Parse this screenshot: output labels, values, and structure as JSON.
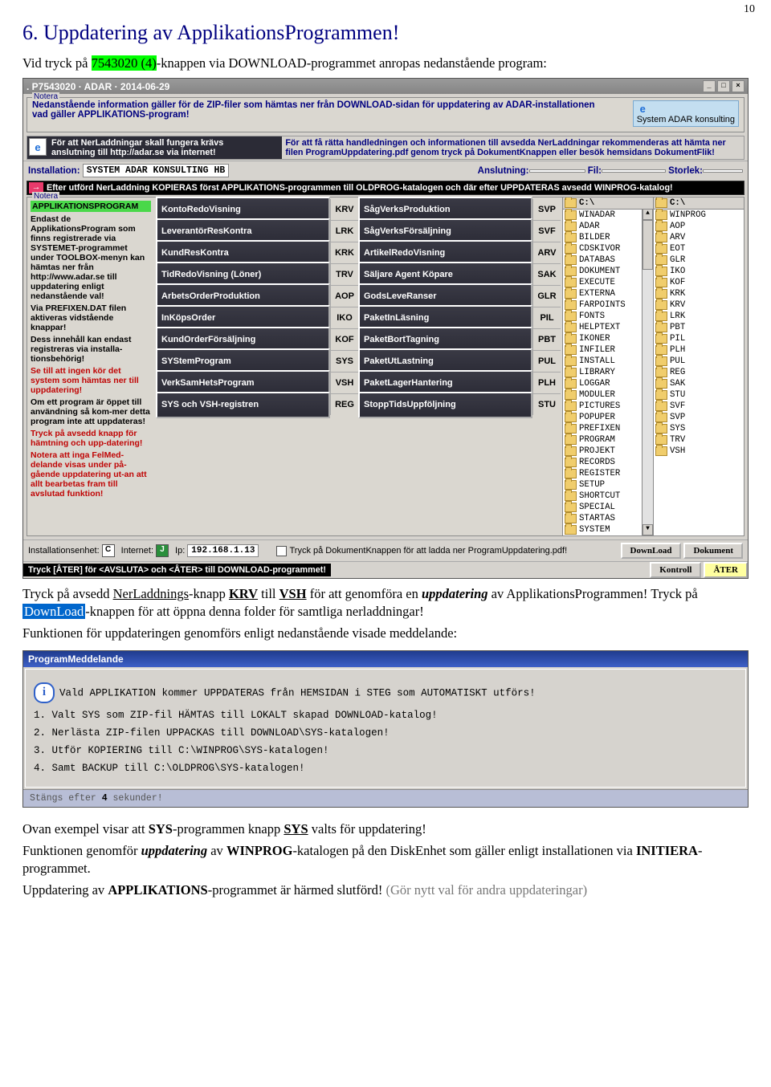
{
  "page_number": "10",
  "h1_num": "6.",
  "h1_text": " Uppdatering av ApplikationsProgrammen!",
  "intro_1": "Vid tryck på ",
  "intro_hl": "7543020 (4)",
  "intro_2": "-knappen via DOWNLOAD-programmet anropas nedanstående program:",
  "app": {
    "title": ". P7543020 · ADAR · 2014-06-29",
    "notera_label": "Notera",
    "notera1_l1": "Nedanstående information gäller för de ZIP-filer som hämtas ner från DOWNLOAD-sidan för uppdatering av ADAR-installationen",
    "notera1_l2": "vad gäller APPLIKATIONS-program!",
    "sysadar": "System ADAR konsulting",
    "ie1_l1": "För att NerLaddningar skall fungera krävs",
    "ie1_l2": "anslutning till http://adar.se via internet!",
    "ie1_r1": "För att få rätta handledningen och informationen till avsedda NerLaddningar rekommenderas att hämta ner",
    "ie1_r2": "filen ProgramUppdatering.pdf genom tryck på DokumentKnappen eller besök hemsidans DokumentFlik!",
    "inst_label": "Installation:",
    "inst_val": "SYSTEM ADAR KONSULTING HB",
    "ansl_lbl": "Anslutning:",
    "fil_lbl": "Fil:",
    "storlek_lbl": "Storlek:",
    "blackbar": "Efter utförd NerLaddning KOPIERAS först APPLIKATIONS-programmen till OLDPROG-katalogen och där efter UPPDATERAS avsedd WINPROG-katalog!",
    "appbox_title": "APPLIKATIONSPROGRAM",
    "appbox_l1": "Endast de ApplikationsProgram som finns registrerade via SYSTEMET-programmet under TOOLBOX-menyn kan hämtas ner från http://www.adar.se till uppdatering enligt nedanstående val!",
    "side_p1": "Via PREFIXEN.DAT filen aktiveras vidstående knappar!",
    "side_p2": "Dess innehåll kan endast registreras via installa-tionsbehörig!",
    "side_r1": "Se till att ingen kör det system som hämtas ner till uppdatering!",
    "side_p3": "Om ett program är öppet till användning så kom-mer detta program inte att uppdateras!",
    "side_r2": "Tryck på avsedd knapp för hämtning och upp-datering!",
    "side_p4": "Notera att inga FelMed-delande visas under på-gående uppdatering ut-an att allt bearbetas fram till avslutad funktion!",
    "col1": [
      {
        "t": "KontoRedoVisning",
        "c": "KRV"
      },
      {
        "t": "LeverantörResKontra",
        "c": "LRK"
      },
      {
        "t": "KundResKontra",
        "c": "KRK"
      },
      {
        "t": "TidRedoVisning (Löner)",
        "c": "TRV"
      },
      {
        "t": "ArbetsOrderProduktion",
        "c": "AOP"
      },
      {
        "t": "InKöpsOrder",
        "c": "IKO"
      },
      {
        "t": "KundOrderFörsäljning",
        "c": "KOF"
      },
      {
        "t": "SYStemProgram",
        "c": "SYS"
      },
      {
        "t": "VerkSamHetsProgram",
        "c": "VSH"
      },
      {
        "t": "SYS och VSH-registren",
        "c": "REG"
      }
    ],
    "col2": [
      {
        "t": "SågVerksProduktion",
        "c": "SVP"
      },
      {
        "t": "SågVerksFörsäljning",
        "c": "SVF"
      },
      {
        "t": "ArtikelRedoVisning",
        "c": "ARV"
      },
      {
        "t": "Säljare Agent Köpare",
        "c": "SAK"
      },
      {
        "t": "GodsLeveRanser",
        "c": "GLR"
      },
      {
        "t": "PaketInLäsning",
        "c": "PIL"
      },
      {
        "t": "PaketBortTagning",
        "c": "PBT"
      },
      {
        "t": "PaketUtLastning",
        "c": "PUL"
      },
      {
        "t": "PaketLagerHantering",
        "c": "PLH"
      },
      {
        "t": "StoppTidsUppföljning",
        "c": "STU"
      }
    ],
    "folders1_hdr": "C:\\",
    "folders1": [
      "WINADAR",
      "ADAR",
      "BILDER",
      "CDSKIVOR",
      "DATABAS",
      "DOKUMENT",
      "EXECUTE",
      "EXTERNA",
      "FARPOINTS",
      "FONTS",
      "HELPTEXT",
      "IKONER",
      "INFILER",
      "INSTALL",
      "LIBRARY",
      "LOGGAR",
      "MODULER",
      "PICTURES",
      "POPUPER",
      "PREFIXEN",
      "PROGRAM",
      "PROJEKT",
      "RECORDS",
      "REGISTER",
      "SETUP",
      "SHORTCUT",
      "SPECIAL",
      "STARTAS",
      "SYSTEM"
    ],
    "folders2_hdr": "C:\\",
    "folders2": [
      "WINPROG",
      "AOP",
      "ARV",
      "EOT",
      "GLR",
      "IKO",
      "KOF",
      "KRK",
      "KRV",
      "LRK",
      "PBT",
      "PIL",
      "PLH",
      "PUL",
      "REG",
      "SAK",
      "STU",
      "SVF",
      "SVP",
      "SYS",
      "TRV",
      "VSH"
    ],
    "bot_inst": "Installationsenhet:",
    "bot_inst_v": "C",
    "bot_net": "Internet:",
    "bot_net_v": "J",
    "bot_ip_lbl": "Ip:",
    "bot_ip": "192.168.1.13",
    "bot_chk": "Tryck på DokumentKnappen för att ladda ner ProgramUppdatering.pdf!",
    "btn_dl": "DownLoad",
    "btn_dok": "Dokument",
    "btn_ktrl": "Kontroll",
    "btn_ater": "ÅTER",
    "foot_black": "Tryck [ÅTER] för <AVSLUTA> och <ÅTER> till DOWNLOAD-programmet!"
  },
  "p2_a": "Tryck på avsedd ",
  "p2_b": "NerLaddnings",
  "p2_c": "-knapp ",
  "p2_d": "KRV",
  "p2_e": " till ",
  "p2_f": "VSH",
  "p2_g": " för att genomföra en ",
  "p2_h": "uppdatering",
  "p2_i": " av ApplikationsProgrammen! Tryck på ",
  "p2_j": "DownLoad",
  "p2_k": "-knappen för att öppna denna folder för samtliga nerladdningar!",
  "p3": "Funktionen för uppdateringen genomförs enligt nedanstående visade meddelande:",
  "dlg": {
    "title": "ProgramMeddelande",
    "l0": "Vald APPLIKATION kommer UPPDATERAS från HEMSIDAN i STEG som AUTOMATISKT utförs!",
    "l1": "1. Valt SYS som ZIP-fil HÄMTAS till LOKALT skapad DOWNLOAD-katalog!",
    "l2": "2. Nerlästa ZIP-filen UPPACKAS till DOWNLOAD\\SYS-katalogen!",
    "l3": "3. Utför KOPIERING till C:\\WINPROG\\SYS-katalogen!",
    "l4": "4. Samt BACKUP till C:\\OLDPROG\\SYS-katalogen!",
    "foot_a": "Stängs efter ",
    "foot_n": "4",
    "foot_b": " sekunder!"
  },
  "p4_a": "Ovan exempel visar att ",
  "p4_b": "SYS",
  "p4_c": "-programmen knapp ",
  "p4_d": "SYS",
  "p4_e": " valts för uppdatering!",
  "p5_a": "Funktionen genomför ",
  "p5_b": "uppdatering",
  "p5_c": " av ",
  "p5_d": "WINPROG",
  "p5_e": "-katalogen på den DiskEnhet som gäller enligt installationen via ",
  "p5_f": "INITIERA",
  "p5_g": "-programmet.",
  "p6_a": "Uppdatering av ",
  "p6_b": "APPLIKATIONS",
  "p6_c": "-programmet är härmed slutförd!",
  "p6_grey": "(Gör nytt val för andra uppdateringar)"
}
